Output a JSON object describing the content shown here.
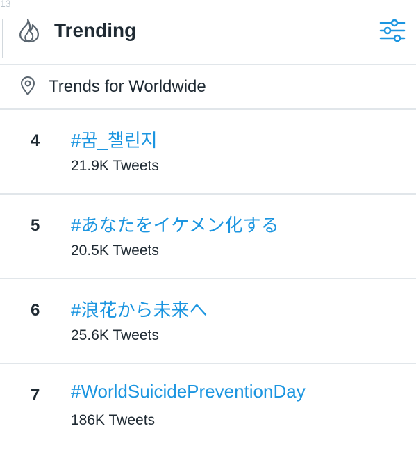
{
  "corner_number": "13",
  "header": {
    "title": "Trending",
    "icon": "flame-icon",
    "settings_icon": "sliders-icon"
  },
  "location": {
    "icon": "location-pin-icon",
    "label": "Trends for Worldwide"
  },
  "trends": [
    {
      "rank": "4",
      "tag": "#꿈_챌린지",
      "count": "21.9K Tweets"
    },
    {
      "rank": "5",
      "tag": "#あなたをイケメン化する",
      "count": "20.5K Tweets"
    },
    {
      "rank": "6",
      "tag": "#浪花から未来へ",
      "count": "25.6K Tweets"
    },
    {
      "rank": "7",
      "tag": "#WorldSuicidePreventionDay",
      "count": "186K Tweets"
    }
  ],
  "colors": {
    "accent": "#1b95e0",
    "text": "#1f2a33",
    "divider": "#e1e6ea"
  }
}
